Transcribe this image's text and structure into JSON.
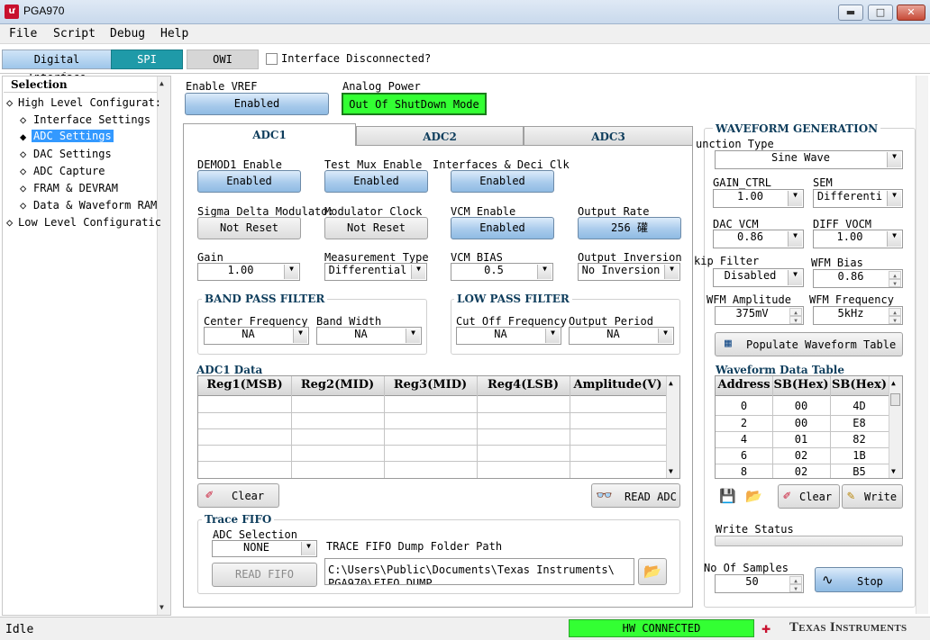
{
  "window": {
    "title": "PGA970",
    "buttons": [
      "▬",
      "□",
      "✕"
    ]
  },
  "menu": [
    "File",
    "Script",
    "Debug",
    "Help"
  ],
  "top_tabs": {
    "digital": "Digital Interface",
    "spi": "SPI",
    "owi": "OWI",
    "checkbox_label": "Interface Disconnected?"
  },
  "tree": {
    "header": "Selection",
    "items": [
      "High Level Configurat:",
      "Interface Settings",
      "ADC Settings",
      "DAC Settings",
      "ADC Capture",
      "FRAM & DEVRAM",
      "Data & Waveform RAM",
      "Low Level Configuratic"
    ]
  },
  "vref": {
    "label": "Enable VREF",
    "value": "Enabled"
  },
  "analog_power": {
    "label": "Analog Power",
    "value": "Out Of ShutDown Mode"
  },
  "adc_tabs": [
    "ADC1",
    "ADC2",
    "ADC3"
  ],
  "adc1": {
    "demod1": {
      "label": "DEMOD1 Enable",
      "value": "Enabled"
    },
    "test_mux": {
      "label": "Test Mux Enable",
      "value": "Enabled"
    },
    "interfaces": {
      "label": "Interfaces & Deci Clk",
      "value": "Enabled"
    },
    "sigma": {
      "label": "Sigma Delta Modulato:",
      "value": "Not Reset"
    },
    "mod_clock": {
      "label": "Modulator Clock",
      "value": "Not Reset"
    },
    "vcm_enable": {
      "label": "VCM Enable",
      "value": "Enabled"
    },
    "output_rate": {
      "label": "Output Rate",
      "value": "256 礶"
    },
    "gain": {
      "label": "Gain",
      "value": "1.00"
    },
    "measurement": {
      "label": "Measurement Type",
      "value": "Differential"
    },
    "vcm_bias": {
      "label": "VCM BIAS",
      "value": "0.5"
    },
    "output_inversion": {
      "label": "Output Inversion",
      "value": "No Inversion"
    },
    "bandpass": {
      "title": "BAND PASS FILTER",
      "center_label": "Center Frequency",
      "center_value": "NA",
      "bw_label": "Band Width",
      "bw_value": "NA"
    },
    "lowpass": {
      "title": "LOW PASS FILTER",
      "cutoff_label": "Cut Off Frequency",
      "cutoff_value": "NA",
      "period_label": "Output Period",
      "period_value": "NA"
    },
    "data_title": "ADC1 Data",
    "data_headers": [
      "Reg1(MSB)",
      "Reg2(MID)",
      "Reg3(MID)",
      "Reg4(LSB)",
      "Amplitude(V)"
    ],
    "clear_label": "Clear",
    "read_adc_label": "READ ADC",
    "trace": {
      "title": "Trace FIFO",
      "adc_sel_label": "ADC Selection",
      "adc_sel_value": "NONE",
      "read_fifo_label": "READ FIFO",
      "path_label": "TRACE FIFO Dump Folder Path",
      "path_line1": "C:\\Users\\Public\\Documents\\Texas Instruments\\",
      "path_line2": "PGA970\\FIFO_DUMP"
    }
  },
  "wave": {
    "title": "WAVEFORM GENERATION",
    "func_label": "unction Type",
    "func_value": "Sine Wave",
    "gain_ctrl_label": "GAIN_CTRL",
    "gain_ctrl_value": "1.00",
    "sem_label": "SEM",
    "sem_value": "Differenti",
    "dac_vcm_label": "DAC VCM",
    "dac_vcm_value": "0.86",
    "diff_vocm_label": "DIFF VOCM",
    "diff_vocm_value": "1.00",
    "skip_label": "kip Filter",
    "skip_value": "Disabled",
    "wfm_bias_label": "WFM Bias",
    "wfm_bias_value": "0.86",
    "amp_label": "WFM Amplitude",
    "amp_value": "375mV",
    "freq_label": "WFM Frequency",
    "freq_value": "5kHz",
    "populate_label": "Populate Waveform Table",
    "table_title": "Waveform Data Table",
    "table_headers": [
      "Address",
      "SB(Hex)",
      "SB(Hex)"
    ],
    "table_rows": [
      [
        "0",
        "00",
        "4D"
      ],
      [
        "2",
        "00",
        "E8"
      ],
      [
        "4",
        "01",
        "82"
      ],
      [
        "6",
        "02",
        "1B"
      ],
      [
        "8",
        "02",
        "B5"
      ]
    ],
    "clear_label": "Clear",
    "write_label": "Write",
    "write_status_label": "Write Status",
    "samples_label": "No Of  Samples",
    "samples_value": "50",
    "stop_label": "Stop"
  },
  "status": {
    "left": "Idle",
    "hw": "HW CONNECTED",
    "brand": "Texas Instruments"
  },
  "colors": {
    "green": "#33ff33",
    "accent_blue": "#a9cbec",
    "ti_red": "#c8102e"
  }
}
